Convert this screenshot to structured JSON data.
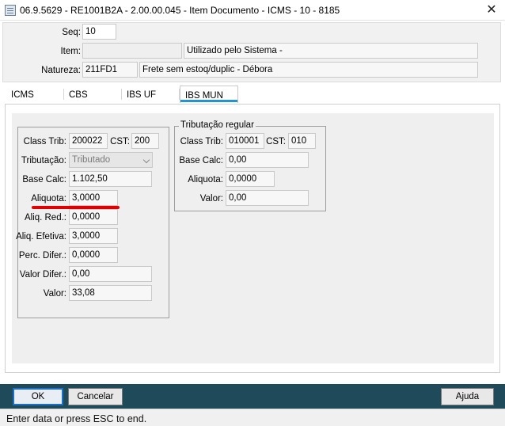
{
  "window": {
    "title": "06.9.5629 - RE1001B2A - 2.00.00.045 - Item Documento - ICMS - 10 - 8185",
    "close_glyph": "✕"
  },
  "header": {
    "seq_label": "Seq:",
    "seq_value": "10",
    "item_label": "Item:",
    "item_code": "",
    "item_description": "Utilizado pelo Sistema -",
    "natureza_label": "Natureza:",
    "natureza_code": "211FD1",
    "natureza_description": "Frete sem estoq/duplic - Débora"
  },
  "tabs": [
    {
      "label": "ICMS",
      "active": false
    },
    {
      "label": "CBS",
      "active": false
    },
    {
      "label": "IBS UF",
      "active": false
    },
    {
      "label": "IBS MUN",
      "active": true
    }
  ],
  "ibs_mun": {
    "class_trib_label": "Class Trib:",
    "class_trib_value": "200022",
    "cst_label": "CST:",
    "cst_value": "200",
    "tributacao_label": "Tributação:",
    "tributacao_value": "Tributado",
    "base_calc_label": "Base Calc:",
    "base_calc_value": "1.102,50",
    "aliquota_label": "Aliquota:",
    "aliquota_value": "3,0000",
    "aliq_red_label": "Aliq. Red.:",
    "aliq_red_value": "0,0000",
    "aliq_efetiva_label": "Aliq. Efetiva:",
    "aliq_efetiva_value": "3,0000",
    "perc_difer_label": "Perc. Difer.:",
    "perc_difer_value": "0,0000",
    "valor_difer_label": "Valor Difer.:",
    "valor_difer_value": "0,00",
    "valor_label": "Valor:",
    "valor_value": "33,08"
  },
  "tributacao_regular": {
    "group_title": "Tributação regular",
    "class_trib_label": "Class Trib:",
    "class_trib_value": "010001",
    "cst_label": "CST:",
    "cst_value": "010",
    "base_calc_label": "Base Calc:",
    "base_calc_value": "0,00",
    "aliquota_label": "Aliquota:",
    "aliquota_value": "0,0000",
    "valor_label": "Valor:",
    "valor_value": "0,00"
  },
  "footer": {
    "ok_label": "OK",
    "cancel_label": "Cancelar",
    "help_label": "Ajuda"
  },
  "status": {
    "text": "Enter data or press ESC to end."
  },
  "colors": {
    "footer_bg": "#1e4a5a",
    "active_tab_accent": "#2493d1",
    "highlight_underline": "#e00000"
  }
}
